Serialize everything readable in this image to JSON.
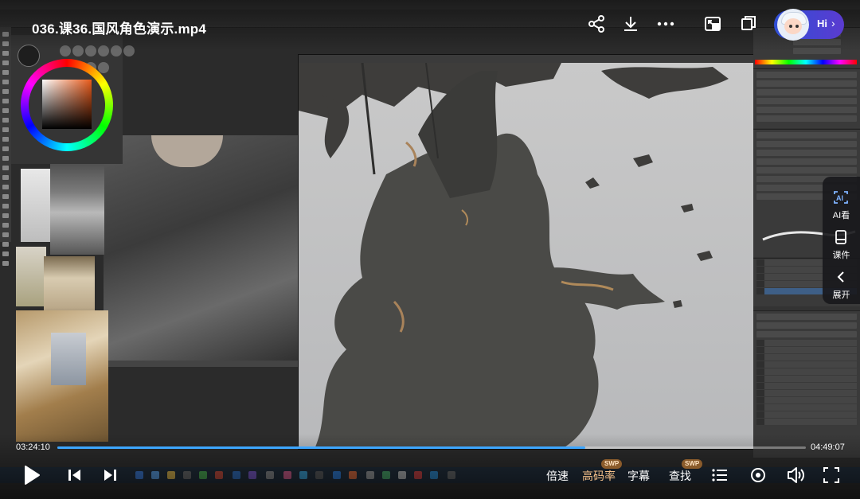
{
  "video": {
    "title": "036.课36.国风角色演示.mp4",
    "current_time": "03:24:10",
    "total_time": "04:49:07",
    "progress_fraction": 0.705
  },
  "top_actions": [
    "share-icon",
    "download-icon",
    "more-icon",
    "picture-in-picture-icon",
    "fullscreen-window-icon"
  ],
  "assistant": {
    "greeting": "Hi",
    "chevron": "›"
  },
  "side_menu": {
    "items": [
      {
        "label": "AI看",
        "icon": "ai-watch-icon"
      },
      {
        "label": "课件",
        "icon": "courseware-icon"
      },
      {
        "label": "展开",
        "icon": "expand-left-icon"
      }
    ]
  },
  "controls": {
    "speed": "倍速",
    "quality": "高码率",
    "quality_badge": "SWP",
    "subtitles": "字幕",
    "find": "查找",
    "find_badge": "SWP"
  },
  "colors": {
    "accent": "#3da6ff",
    "badge_text": "#f5c18a",
    "assistant_gradient_start": "#2f4fd6",
    "assistant_gradient_end": "#5b3bd0"
  }
}
